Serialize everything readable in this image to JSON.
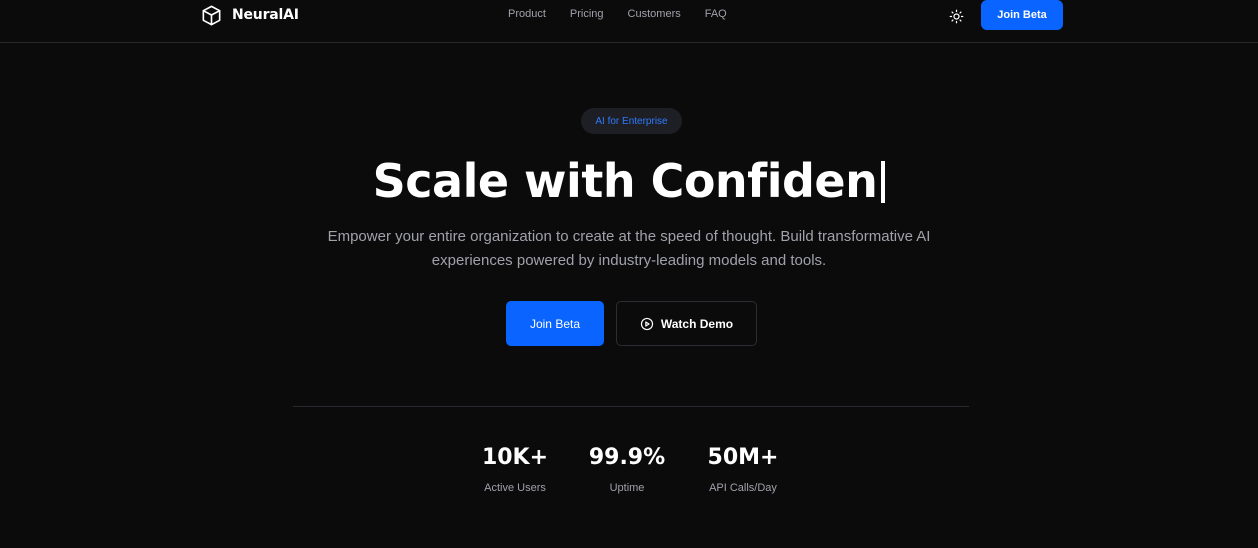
{
  "header": {
    "brand": "NeuralAI",
    "nav": [
      "Product",
      "Pricing",
      "Customers",
      "FAQ"
    ],
    "cta": "Join Beta",
    "theme_icon": "sun-icon",
    "logo_icon": "cube-icon"
  },
  "hero": {
    "badge": "AI for Enterprise",
    "headline": "Scale with Confiden",
    "subtitle_line1": "Empower your entire organization to create at the speed of thought. Build transformative AI",
    "subtitle_line2": "experiences powered by industry-leading models and tools.",
    "primary_cta": "Join Beta",
    "secondary_cta": "Watch Demo",
    "secondary_icon": "play-circle-icon"
  },
  "stats": [
    {
      "value": "10K+",
      "label": "Active Users"
    },
    {
      "value": "99.9%",
      "label": "Uptime"
    },
    {
      "value": "50M+",
      "label": "API Calls/Day"
    }
  ],
  "colors": {
    "background": "#0b0b0c",
    "accent": "#0a64ff",
    "badge_text": "#2f7bff",
    "muted_text": "#a1a1aa"
  }
}
